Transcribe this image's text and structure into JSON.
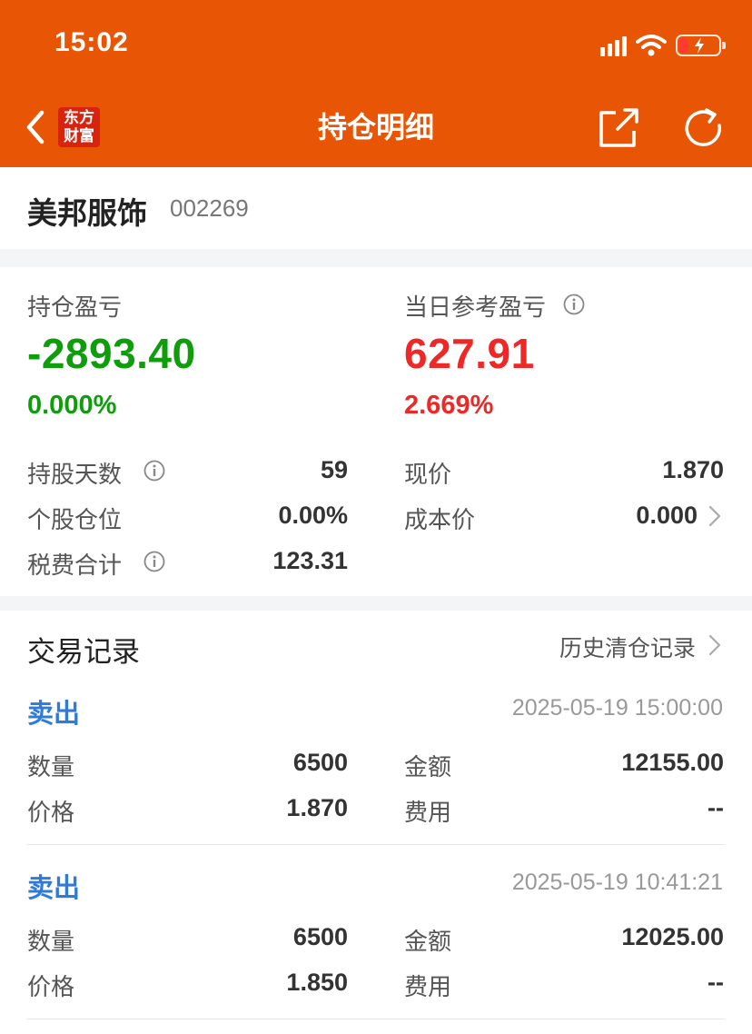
{
  "status_bar": {
    "time": "15:02"
  },
  "header": {
    "title": "持仓明细",
    "logo_line1": "东方",
    "logo_line2": "财富"
  },
  "stock": {
    "name": "美邦服饰",
    "code": "002269"
  },
  "summary": {
    "position_pnl_label": "持仓盈亏",
    "position_pnl_value": "-2893.40",
    "position_pnl_pct": "0.000%",
    "daily_pnl_label": "当日参考盈亏",
    "daily_pnl_value": "627.91",
    "daily_pnl_pct": "2.669%",
    "holding_days_label": "持股天数",
    "holding_days_value": "59",
    "position_ratio_label": "个股仓位",
    "position_ratio_value": "0.00%",
    "fees_label": "税费合计",
    "fees_value": "123.31",
    "current_price_label": "现价",
    "current_price_value": "1.870",
    "cost_price_label": "成本价",
    "cost_price_value": "0.000"
  },
  "trades_section": {
    "title": "交易记录",
    "history_link": "历史清仓记录",
    "trades": [
      {
        "type": "卖出",
        "time": "2025-05-19 15:00:00",
        "qty_label": "数量",
        "qty": "6500",
        "amount_label": "金额",
        "amount": "12155.00",
        "price_label": "价格",
        "price": "1.870",
        "fee_label": "费用",
        "fee": "--"
      },
      {
        "type": "卖出",
        "time": "2025-05-19 10:41:21",
        "qty_label": "数量",
        "qty": "6500",
        "amount_label": "金额",
        "amount": "12025.00",
        "price_label": "价格",
        "price": "1.850",
        "fee_label": "费用",
        "fee": "--"
      }
    ]
  },
  "colors": {
    "header_bg": "#e85605",
    "loss_green": "#0f9d0c",
    "gain_red": "#ee2727",
    "link_blue": "#2f7bd6"
  },
  "icons": [
    "back-icon",
    "logo",
    "share-icon",
    "refresh-icon",
    "info-icon",
    "chevron-right-icon",
    "signal-icon",
    "wifi-icon",
    "battery-icon"
  ]
}
